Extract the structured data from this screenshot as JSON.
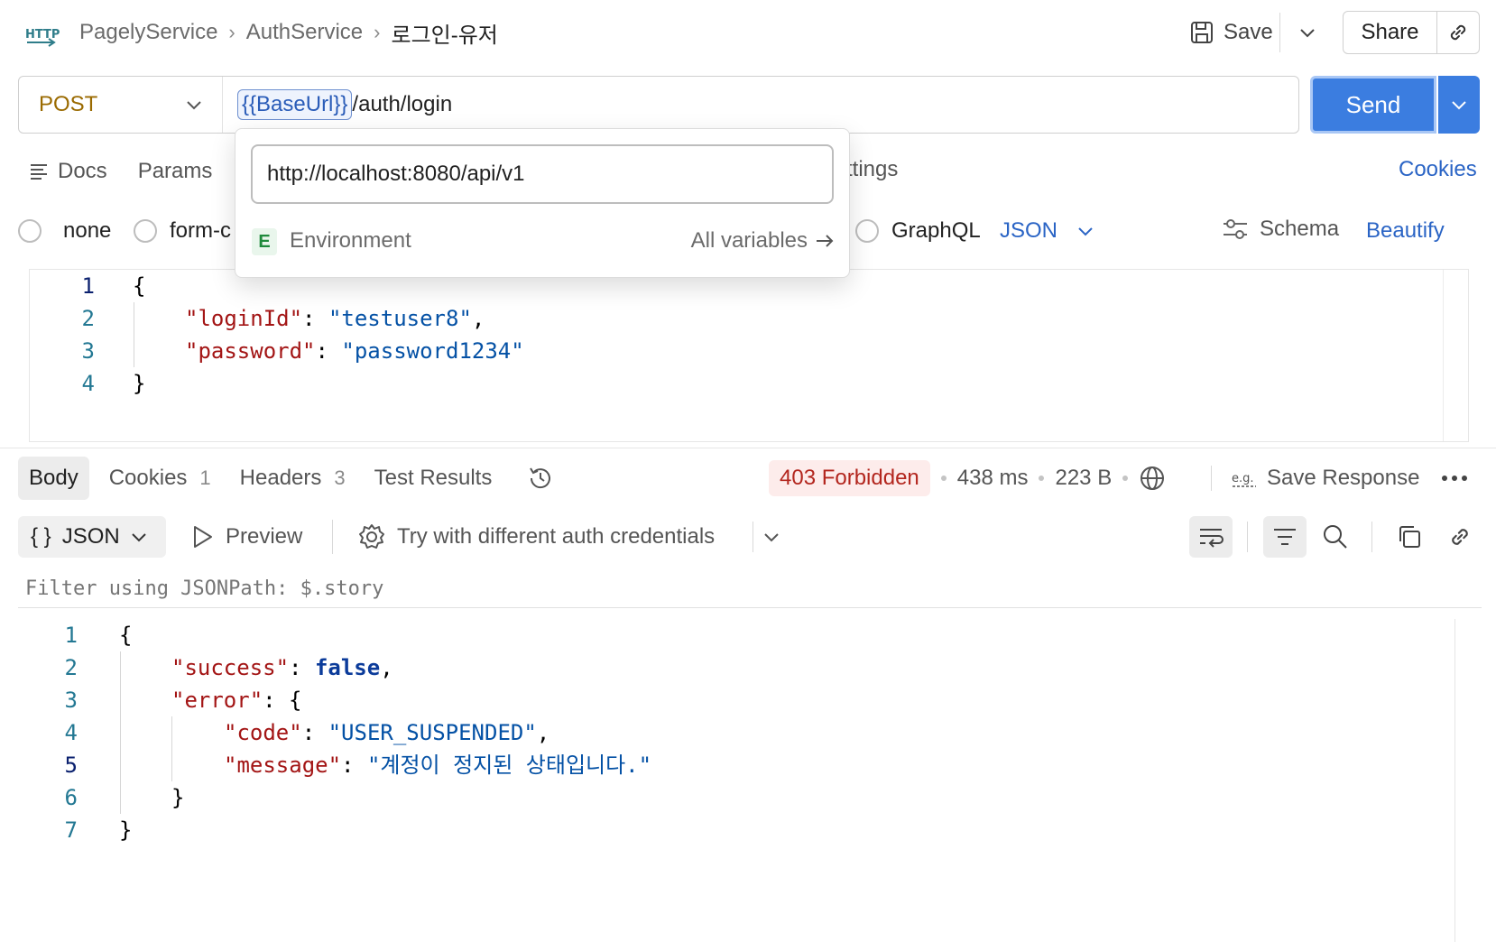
{
  "header": {
    "logo_text": "HTTP",
    "breadcrumb": [
      "PagelyService",
      "AuthService",
      "로그인-유저"
    ],
    "save_label": "Save",
    "share_label": "Share"
  },
  "request": {
    "method": "POST",
    "url_variable": "{{BaseUrl}}",
    "url_path": "/auth/login",
    "send_label": "Send",
    "tabs": [
      "Docs",
      "Params"
    ],
    "tab_settings_fragment": "ttings",
    "cookies_label": "Cookies",
    "body_types": {
      "none": "none",
      "form": "form-c",
      "graphql": "GraphQL",
      "json": "JSON"
    },
    "schema_label": "Schema",
    "beautify_label": "Beautify",
    "body_lines": [
      "1",
      "2",
      "3",
      "4"
    ]
  },
  "variable_popup": {
    "value": "http://localhost:8080/api/v1",
    "scope_badge": "E",
    "scope_label": "Environment",
    "all_variables_label": "All variables"
  },
  "response": {
    "tabs": {
      "body": "Body",
      "cookies": "Cookies",
      "cookies_count": "1",
      "headers": "Headers",
      "headers_count": "3",
      "tests": "Test Results"
    },
    "status": "403 Forbidden",
    "time": "438 ms",
    "size": "223 B",
    "save_response_label": "Save Response",
    "format": "JSON",
    "preview_label": "Preview",
    "try_label": "Try with different auth credentials",
    "filter_placeholder": "Filter using JSONPath: $.story",
    "body_lines": [
      "1",
      "2",
      "3",
      "4",
      "5",
      "6",
      "7"
    ]
  },
  "colors": {
    "send": "#3b7de0",
    "status_bg": "#fdeceb",
    "status_text": "#b3261e",
    "link": "#2a64c5"
  }
}
